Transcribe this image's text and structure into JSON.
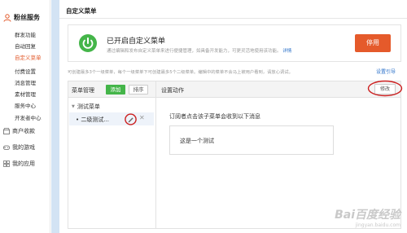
{
  "sidebar": {
    "section_title": "粉丝服务",
    "items": [
      {
        "label": "群发功能"
      },
      {
        "label": "自动回复"
      },
      {
        "label": "自定义菜单",
        "active": true
      },
      {
        "label": "付费设置"
      },
      {
        "label": "消息管理"
      },
      {
        "label": "素材管理"
      },
      {
        "label": "服务中心"
      },
      {
        "label": "开发者中心"
      }
    ],
    "groups": [
      {
        "label": "商户收款",
        "icon": "shop-icon"
      },
      {
        "label": "我的游戏",
        "icon": "gamepad-icon"
      },
      {
        "label": "我的应用",
        "icon": "apps-icon"
      }
    ]
  },
  "page": {
    "title": "自定义菜单"
  },
  "banner": {
    "title": "已开启自定义菜单",
    "desc": "通过编辑和发布自定义菜单来进行便捷管理，如具备开发能力，可更灵活地使用该功能。",
    "link": "详情",
    "button": "停用"
  },
  "notice": "可创建最多3个一级菜单，每个一级菜单下可创建最多5个二级菜单。编辑中的菜单不会马上被用户看到，请放心调试。",
  "guide_link": "设置引导",
  "menu_panel": {
    "title": "菜单管理",
    "add_label": "添加",
    "sort_label": "排序",
    "tree": {
      "parent": "测试菜单",
      "child": "二级测试..."
    }
  },
  "action_panel": {
    "title": "设置动作",
    "modify_label": "修改",
    "subscriber_text": "订阅者点击该子菜单会收到以下消息",
    "message": "这是一个测试"
  },
  "watermark": {
    "logo": "Bai百度经验",
    "url": "jingyan.baidu.com"
  },
  "colors": {
    "accent": "#e55a2b",
    "green": "#44b549",
    "link": "#2a70c9",
    "annotation": "#cc1f1f"
  }
}
